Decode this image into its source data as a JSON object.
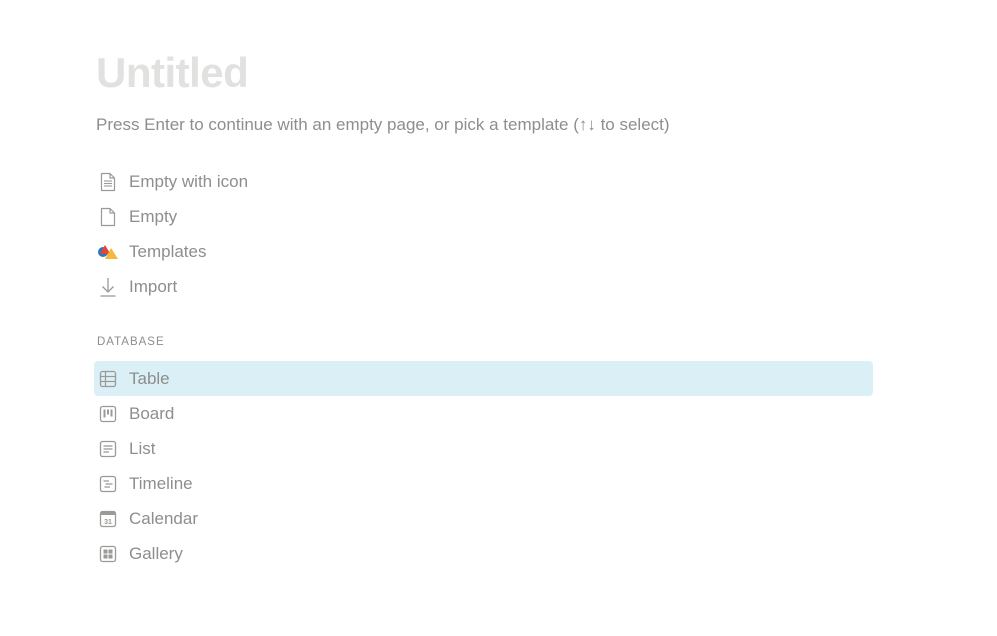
{
  "page": {
    "title": "Untitled",
    "hint": "Press Enter to continue with an empty page, or pick a template (↑↓ to select)"
  },
  "templates": {
    "items": [
      {
        "label": "Empty with icon",
        "icon": "page-with-lines-icon"
      },
      {
        "label": "Empty",
        "icon": "blank-page-icon"
      },
      {
        "label": "Templates",
        "icon": "templates-shapes-icon"
      },
      {
        "label": "Import",
        "icon": "import-arrow-icon"
      }
    ]
  },
  "database": {
    "section_label": "DATABASE",
    "selected_index": 0,
    "highlight_color": "#daf0f6",
    "items": [
      {
        "label": "Table",
        "icon": "table-icon"
      },
      {
        "label": "Board",
        "icon": "board-icon"
      },
      {
        "label": "List",
        "icon": "list-icon"
      },
      {
        "label": "Timeline",
        "icon": "timeline-icon"
      },
      {
        "label": "Calendar",
        "icon": "calendar-icon"
      },
      {
        "label": "Gallery",
        "icon": "gallery-icon"
      }
    ]
  },
  "calendar_icon_number": "31"
}
